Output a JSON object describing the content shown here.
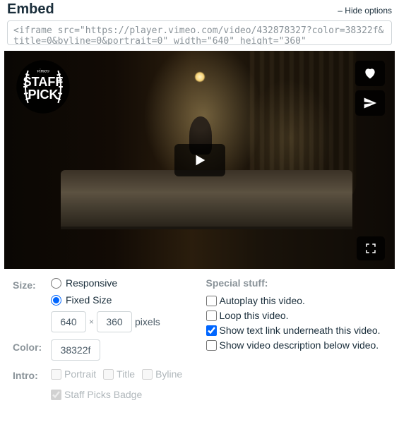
{
  "heading": "Embed",
  "hide_options": "– Hide options",
  "embed_code": "<iframe src=\"https://player.vimeo.com/video/432878327?color=38322f&title=0&byline=0&portrait=0\" width=\"640\" height=\"360\"",
  "staffpick": {
    "brand": "vimeo",
    "line1": "STAFF",
    "line2": "PICK"
  },
  "size": {
    "label": "Size:",
    "responsive": "Responsive",
    "fixed": "Fixed Size",
    "width": "640",
    "height": "360",
    "pixels": "pixels",
    "times": "×"
  },
  "color": {
    "label": "Color:",
    "value": "38322f"
  },
  "intro": {
    "label": "Intro:",
    "portrait": "Portrait",
    "title": "Title",
    "byline": "Byline",
    "staffbadge": "Staff Picks Badge"
  },
  "special": {
    "label": "Special stuff:",
    "autoplay": "Autoplay this video.",
    "loop": "Loop this video.",
    "textlink": "Show text link underneath this video.",
    "desc": "Show video description below video."
  }
}
